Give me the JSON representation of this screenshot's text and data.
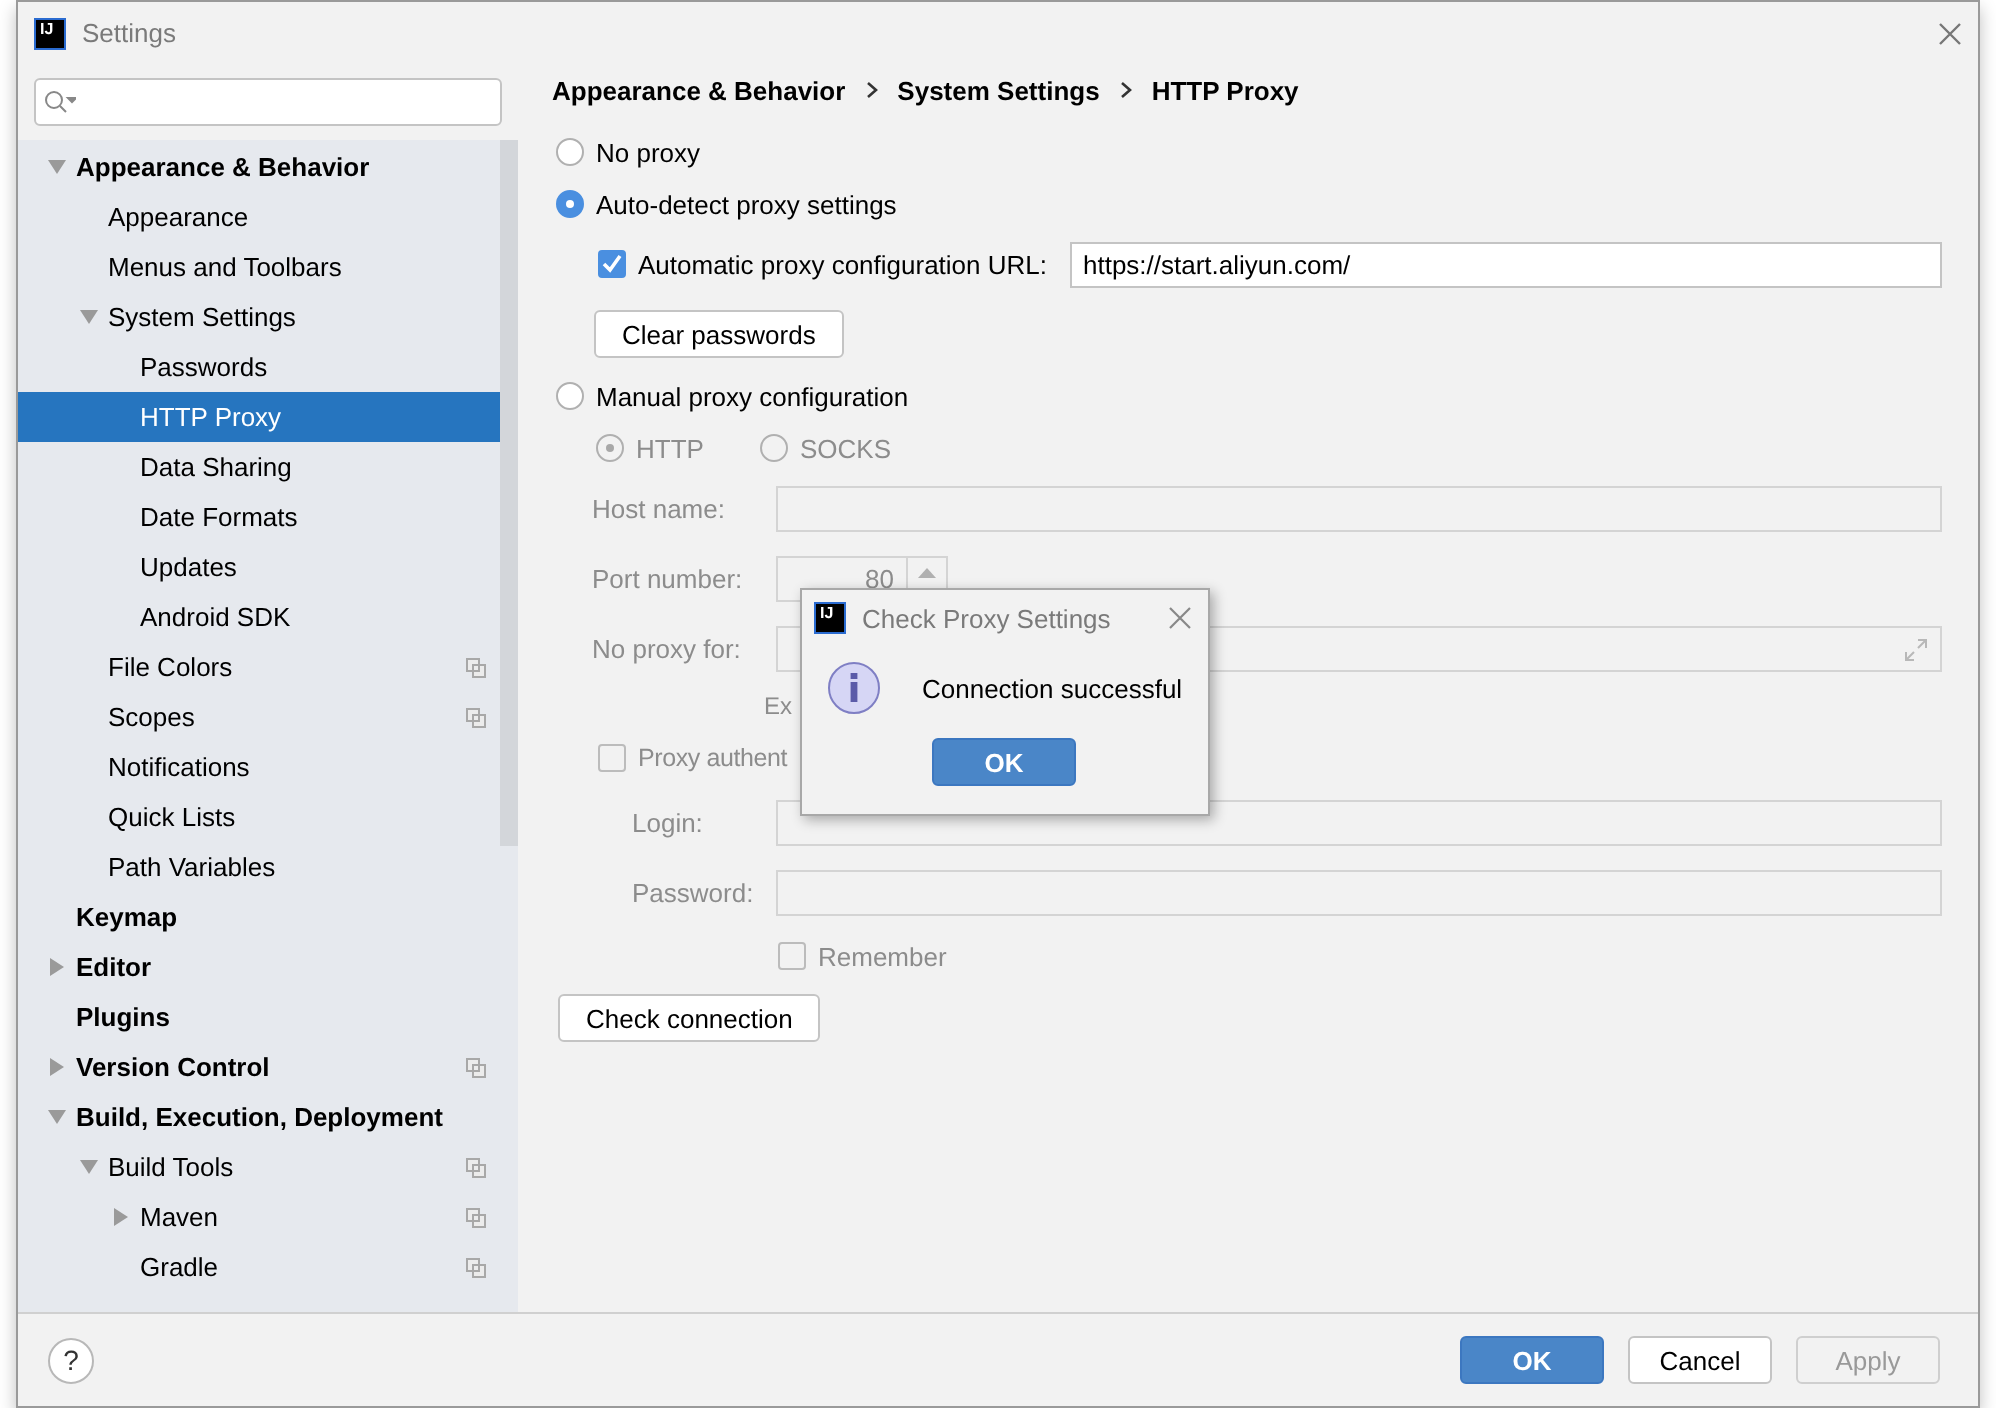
{
  "window": {
    "logo_text": "IJ",
    "title": "Settings"
  },
  "tree": [
    {
      "label": "Appearance & Behavior",
      "bold": true,
      "expanded": true,
      "children": [
        {
          "label": "Appearance"
        },
        {
          "label": "Menus and Toolbars"
        },
        {
          "label": "System Settings",
          "expanded": true,
          "children": [
            {
              "label": "Passwords",
              "selected": false
            },
            {
              "label": "HTTP Proxy",
              "selected": true
            },
            {
              "label": "Data Sharing",
              "selected": false
            },
            {
              "label": "Date Formats",
              "selected": false
            },
            {
              "label": "Updates",
              "selected": false
            },
            {
              "label": "Android SDK",
              "selected": false
            }
          ]
        },
        {
          "label": "File Colors",
          "project": true
        },
        {
          "label": "Scopes",
          "project": true
        },
        {
          "label": "Notifications"
        },
        {
          "label": "Quick Lists"
        },
        {
          "label": "Path Variables"
        }
      ]
    },
    {
      "label": "Keymap",
      "bold": true
    },
    {
      "label": "Editor",
      "bold": true,
      "expanded": false
    },
    {
      "label": "Plugins",
      "bold": true
    },
    {
      "label": "Version Control",
      "bold": true,
      "expanded": false,
      "project": true
    },
    {
      "label": "Build, Execution, Deployment",
      "bold": true,
      "expanded": true,
      "children": [
        {
          "label": "Build Tools",
          "expanded": true,
          "project": true,
          "children": [
            {
              "label": "Maven",
              "expanded": false,
              "project": true
            },
            {
              "label": "Gradle",
              "project": true
            }
          ]
        }
      ]
    }
  ],
  "breadcrumb": [
    "Appearance & Behavior",
    "System Settings",
    "HTTP Proxy"
  ],
  "proxy_modes": [
    {
      "label": "No proxy",
      "selected": false
    },
    {
      "label": "Auto-detect proxy settings",
      "selected": true
    },
    {
      "label": "Manual proxy configuration",
      "selected": false
    }
  ],
  "auto": {
    "checkbox": {
      "label": "Automatic proxy configuration URL:",
      "checked": true
    },
    "url": "https://start.aliyun.com/",
    "clear_button": "Clear passwords"
  },
  "manual": {
    "disabled": true,
    "types": [
      {
        "label": "HTTP",
        "selected": true
      },
      {
        "label": "SOCKS",
        "selected": false
      }
    ],
    "host_label": "Host name:",
    "port_label": "Port number:",
    "port_value": "80",
    "no_proxy_label": "No proxy for:",
    "hint": "Ex",
    "auth": {
      "label": "Proxy authent",
      "checked": false
    },
    "login_label": "Login:",
    "password_label": "Password:",
    "remember": {
      "label": "Remember",
      "checked": false
    }
  },
  "check_button": "Check connection",
  "dialog": {
    "logo_text": "IJ",
    "title": "Check Proxy Settings",
    "message": "Connection successful",
    "button": "OK"
  },
  "footer": {
    "help": "?",
    "buttons": [
      {
        "label": "OK",
        "kind": "primary"
      },
      {
        "label": "Cancel",
        "kind": "normal"
      },
      {
        "label": "Apply",
        "kind": "disabled"
      }
    ]
  }
}
